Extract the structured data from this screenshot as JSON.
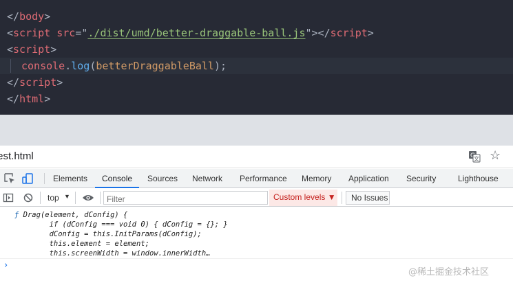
{
  "editor": {
    "lines": [
      {
        "open": "</",
        "tag": "body",
        "close": ">"
      },
      {
        "l2_open": "<",
        "l2_tag": "script",
        "l2_attr": "src",
        "l2_eq": "=\"",
        "l2_src": "./dist/umd/better-draggable-ball.js",
        "l2_q": "\">",
        "l2_end_open": "</",
        "l2_end_tag": "script",
        "l2_end_close": ">"
      },
      {
        "open": "<",
        "tag": "script",
        "close": ">"
      },
      {
        "obj": "console",
        "dot": ".",
        "method": "log",
        "paren_open": "(",
        "arg": "betterDraggableBall",
        "paren_close": ");"
      },
      {
        "open": "</",
        "tag": "script",
        "close": ">"
      },
      {
        "open": "</",
        "tag": "html",
        "close": ">"
      }
    ]
  },
  "devtools": {
    "page_title": "test.html",
    "tabs": [
      "Elements",
      "Console",
      "Sources",
      "Network",
      "Performance",
      "Memory",
      "Application",
      "Security",
      "Lighthouse"
    ],
    "active_tab": "Console",
    "toolbar": {
      "context": "top",
      "filter_placeholder": "Filter",
      "levels": "Custom levels ▼",
      "issues": "No Issues"
    },
    "output": [
      "Drag(element, dConfig) {",
      "        if (dConfig === void 0) { dConfig = {}; }",
      "        dConfig = this.InitParams(dConfig);",
      "        this.element = element;",
      "        this.screenWidth = window.innerWidth…"
    ],
    "fn_glyph": "ƒ",
    "prompt": "›"
  },
  "watermark": "@稀土掘金技术社区",
  "colors": {
    "editor_bg": "#272a35",
    "tag": "#e06c75",
    "string": "#98c379",
    "method": "#61afef",
    "variable": "#d19a66",
    "tab_underline": "#1a73e8",
    "levels_bg": "#fce8e6",
    "levels_text": "#c5221f"
  }
}
